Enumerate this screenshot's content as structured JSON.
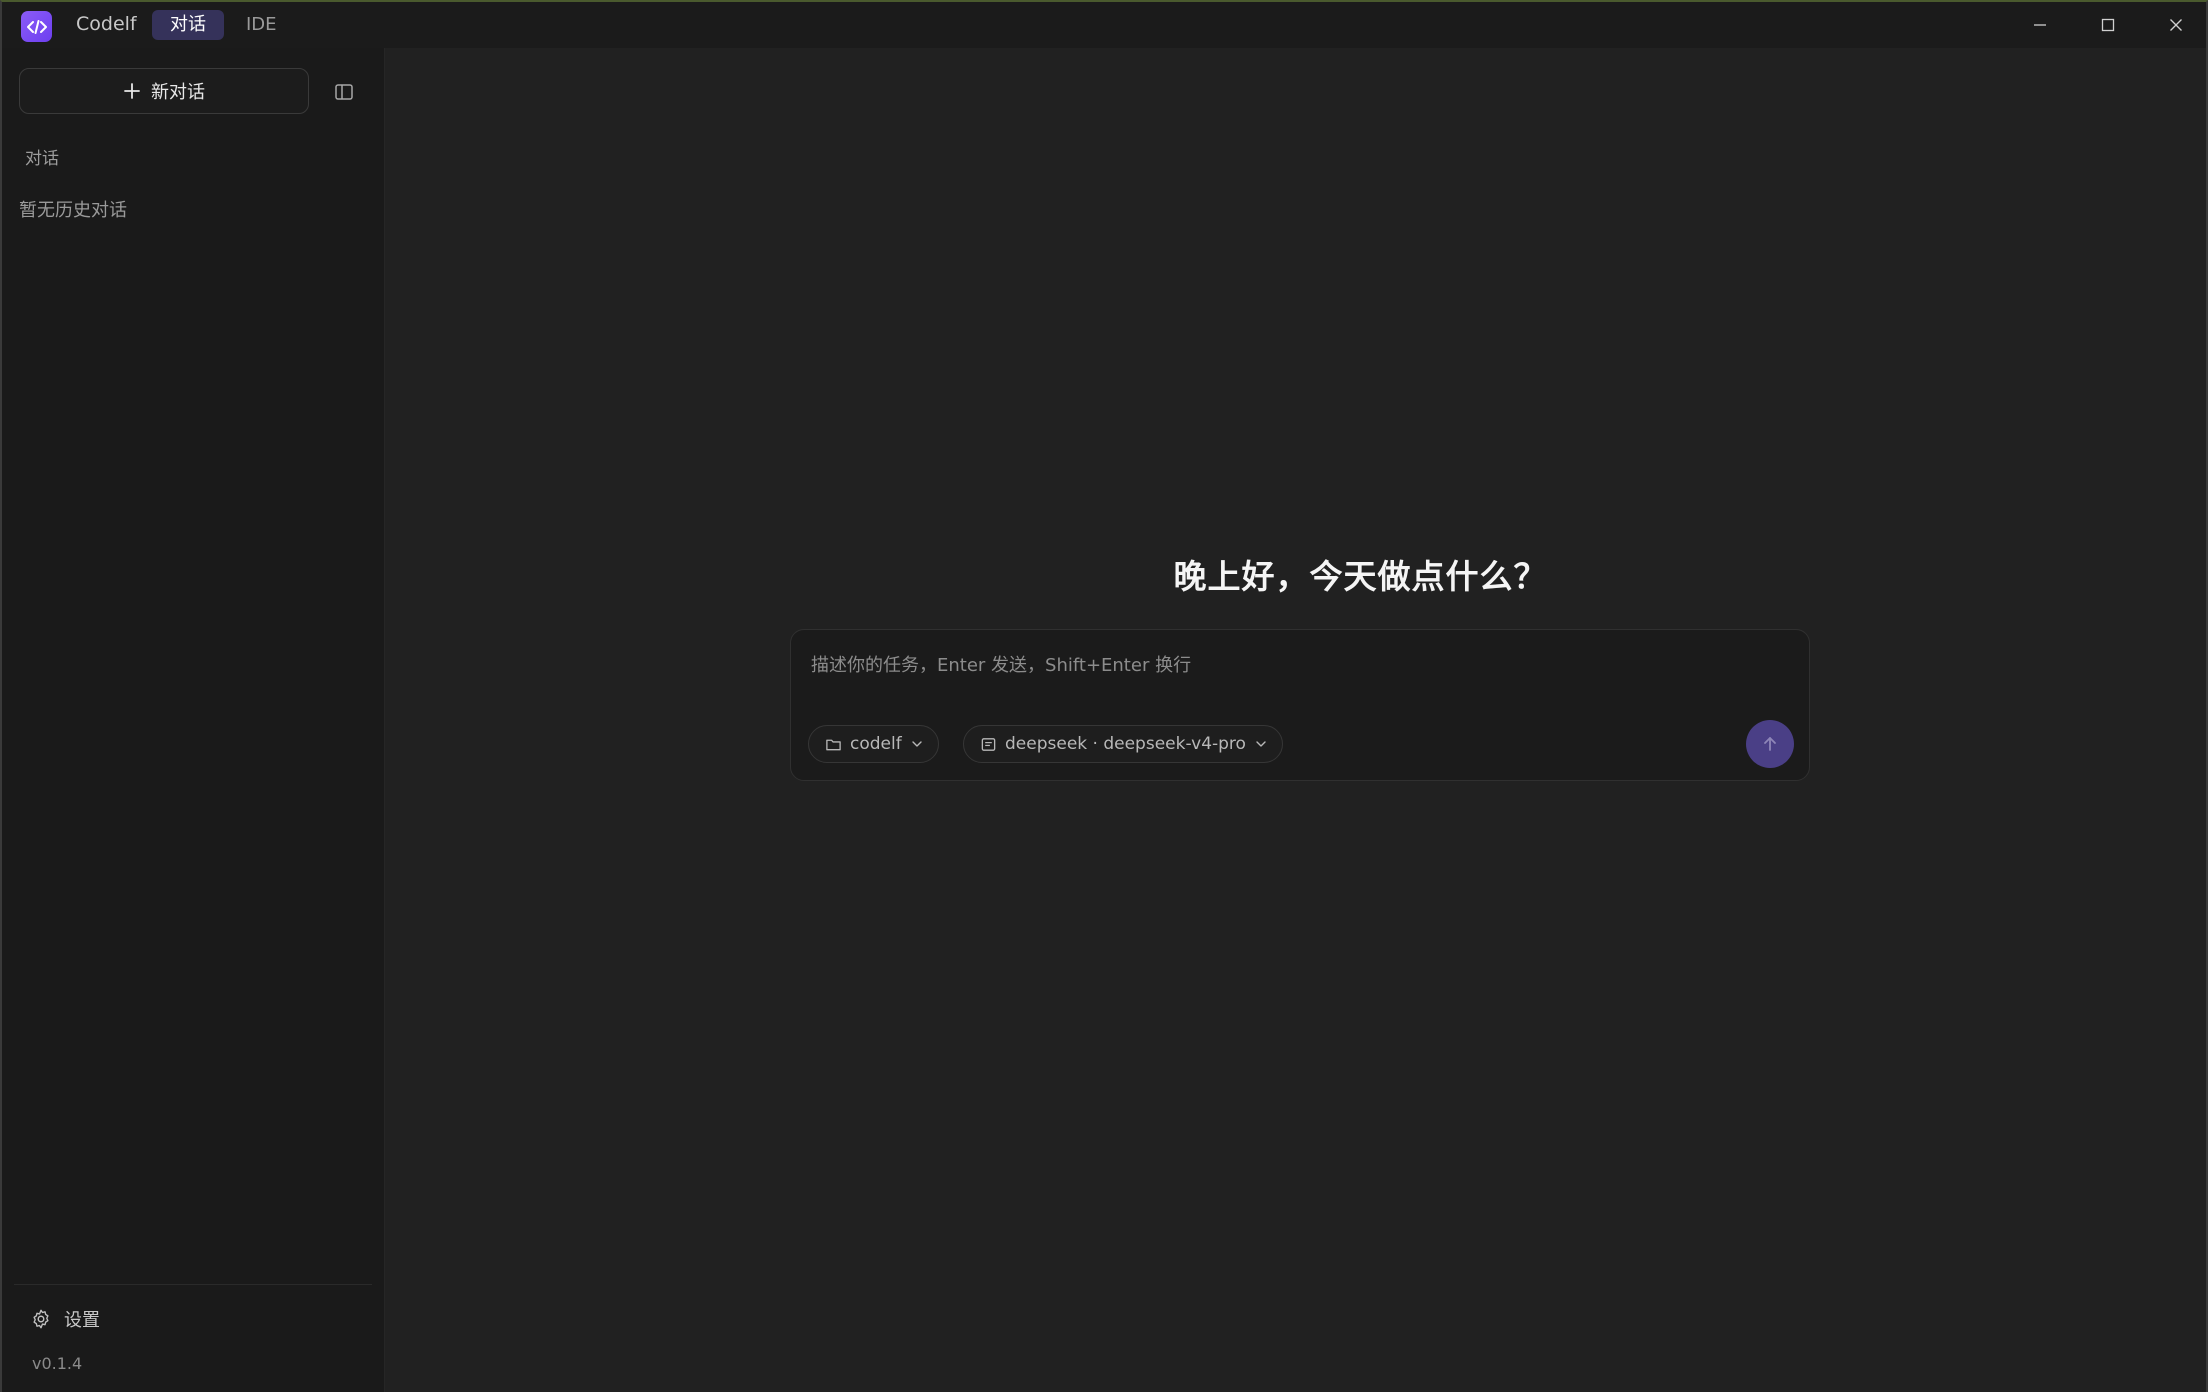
{
  "titlebar": {
    "app_name": "Codelf",
    "tabs": [
      {
        "label": "对话",
        "active": true
      },
      {
        "label": "IDE",
        "active": false
      }
    ],
    "logo_icon": "code-brackets-icon",
    "controls": [
      "minimize-icon",
      "maximize-icon",
      "close-icon"
    ]
  },
  "sidebar": {
    "new_chat_label": "新对话",
    "section_label": "对话",
    "empty_history": "暂无历史对话",
    "settings_label": "设置",
    "version": "v0.1.4"
  },
  "main": {
    "greeting": "晚上好，今天做点什么？",
    "composer": {
      "placeholder": "描述你的任务，Enter 发送，Shift+Enter 换行",
      "value": "",
      "project_chip": "codelf",
      "model_chip": "deepseek · deepseek-v4-pro"
    }
  },
  "colors": {
    "accent": "#7c4dff",
    "active_tab_bg": "#35325a",
    "send_button": "#4a3f86",
    "background": "#212121",
    "sidebar_bg": "#1a1a1a"
  }
}
